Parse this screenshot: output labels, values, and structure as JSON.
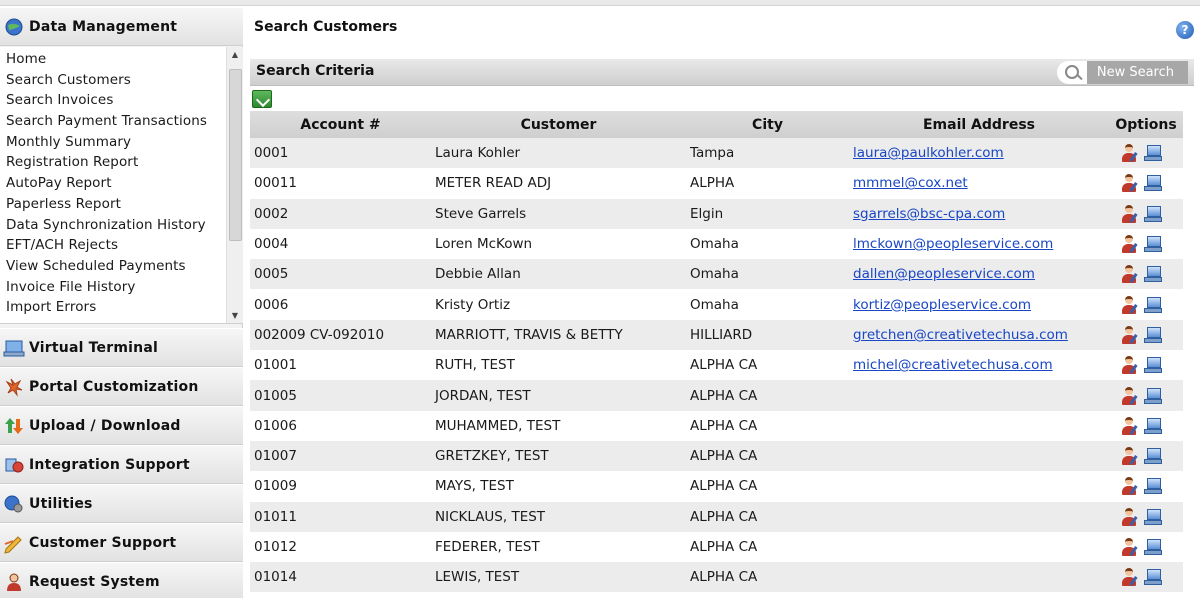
{
  "sidebar": {
    "sections": [
      {
        "label": "Data Management",
        "icon": "globe-info-icon"
      },
      {
        "label": "Virtual Terminal",
        "icon": "computer-icon"
      },
      {
        "label": "Portal Customization",
        "icon": "paint-splash-icon"
      },
      {
        "label": "Upload / Download",
        "icon": "up-down-arrows-icon"
      },
      {
        "label": "Integration Support",
        "icon": "integration-icon"
      },
      {
        "label": "Utilities",
        "icon": "gears-globe-icon"
      },
      {
        "label": "Customer Support",
        "icon": "pencil-support-icon"
      },
      {
        "label": "Request System",
        "icon": "person-request-icon"
      }
    ],
    "items": [
      "Home",
      "Search Customers",
      "Search Invoices",
      "Search Payment Transactions",
      "Monthly Summary",
      "Registration Report",
      "AutoPay Report",
      "Paperless Report",
      "Data Synchronization History",
      "EFT/ACH Rejects",
      "View Scheduled Payments",
      "Invoice File History",
      "Import Errors"
    ]
  },
  "main": {
    "title": "Search Customers",
    "criteria_label": "Search Criteria",
    "new_search_label": "New Search",
    "columns": [
      "Account #",
      "Customer",
      "City",
      "Email Address",
      "Options"
    ],
    "rows": [
      {
        "account": "0001",
        "customer": "Laura Kohler",
        "city": "Tampa",
        "email": "laura@paulkohler.com"
      },
      {
        "account": "00011",
        "customer": "METER READ ADJ",
        "city": "ALPHA",
        "email": "mmmel@cox.net"
      },
      {
        "account": "0002",
        "customer": "Steve Garrels",
        "city": "Elgin",
        "email": "sgarrels@bsc-cpa.com"
      },
      {
        "account": "0004",
        "customer": "Loren McKown",
        "city": "Omaha",
        "email": "lmckown@peopleservice.com"
      },
      {
        "account": "0005",
        "customer": "Debbie Allan",
        "city": "Omaha",
        "email": "dallen@peopleservice.com"
      },
      {
        "account": "0006",
        "customer": "Kristy Ortiz",
        "city": "Omaha",
        "email": "kortiz@peopleservice.com"
      },
      {
        "account": "002009 CV-092010",
        "customer": "MARRIOTT, TRAVIS & BETTY",
        "city": "HILLIARD",
        "email": "gretchen@creativetechusa.com"
      },
      {
        "account": "01001",
        "customer": "RUTH, TEST",
        "city": "ALPHA CA",
        "email": "michel@creativetechusa.com"
      },
      {
        "account": "01005",
        "customer": "JORDAN, TEST",
        "city": "ALPHA CA",
        "email": ""
      },
      {
        "account": "01006",
        "customer": "MUHAMMED, TEST",
        "city": "ALPHA CA",
        "email": ""
      },
      {
        "account": "01007",
        "customer": "GRETZKEY, TEST",
        "city": "ALPHA CA",
        "email": ""
      },
      {
        "account": "01009",
        "customer": "MAYS, TEST",
        "city": "ALPHA CA",
        "email": ""
      },
      {
        "account": "01011",
        "customer": "NICKLAUS, TEST",
        "city": "ALPHA CA",
        "email": ""
      },
      {
        "account": "01012",
        "customer": "FEDERER, TEST",
        "city": "ALPHA CA",
        "email": ""
      },
      {
        "account": "01014",
        "customer": "LEWIS, TEST",
        "city": "ALPHA CA",
        "email": ""
      }
    ]
  },
  "colors": {
    "link": "#1846c4",
    "header_bg": "#d6d6d6",
    "row_alt": "#ececec"
  }
}
